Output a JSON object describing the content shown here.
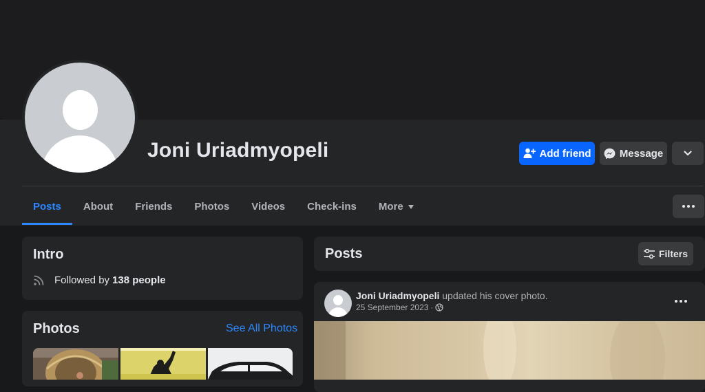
{
  "profile": {
    "name": "Joni Uriadmyopeli"
  },
  "actions": {
    "add_friend": "Add friend",
    "message": "Message"
  },
  "tabs": [
    {
      "label": "Posts"
    },
    {
      "label": "About"
    },
    {
      "label": "Friends"
    },
    {
      "label": "Photos"
    },
    {
      "label": "Videos"
    },
    {
      "label": "Check-ins"
    },
    {
      "label": "More"
    }
  ],
  "intro": {
    "title": "Intro",
    "followed_prefix": "Followed by",
    "followed_count": "138 people"
  },
  "photos": {
    "title": "Photos",
    "see_all": "See All Photos"
  },
  "posts_header": {
    "title": "Posts",
    "filters": "Filters"
  },
  "post": {
    "author": "Joni Uriadmyopeli",
    "action": "updated his cover photo.",
    "date": "25 September 2023"
  },
  "colors": {
    "accent": "#0866ff",
    "link": "#2d88ff",
    "card": "#242526",
    "background": "#18191a"
  }
}
